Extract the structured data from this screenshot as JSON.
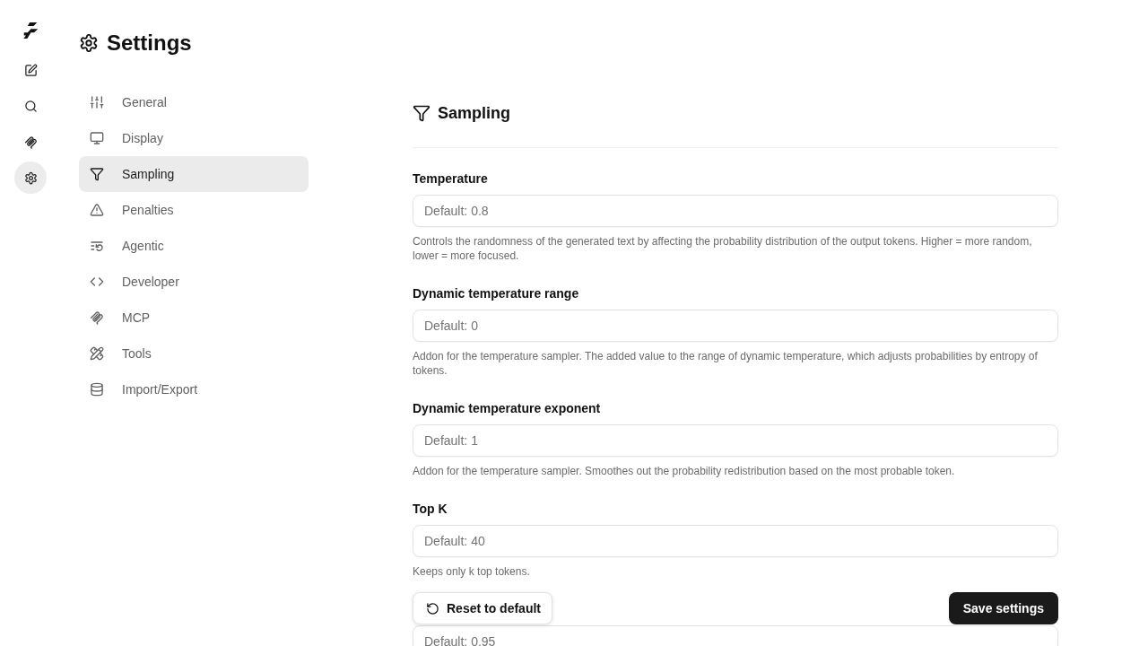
{
  "rail": {
    "items": [
      {
        "selected": false
      },
      {
        "selected": false
      },
      {
        "selected": false
      },
      {
        "selected": true
      }
    ]
  },
  "page_title": "Settings",
  "nav": {
    "items": [
      {
        "label": "General",
        "selected": false
      },
      {
        "label": "Display",
        "selected": false
      },
      {
        "label": "Sampling",
        "selected": true
      },
      {
        "label": "Penalties",
        "selected": false
      },
      {
        "label": "Agentic",
        "selected": false
      },
      {
        "label": "Developer",
        "selected": false
      },
      {
        "label": "MCP",
        "selected": false
      },
      {
        "label": "Tools",
        "selected": false
      },
      {
        "label": "Import/Export",
        "selected": false
      }
    ]
  },
  "section": {
    "title": "Sampling",
    "fields": [
      {
        "label": "Temperature",
        "placeholder": "Default: 0.8",
        "help": "Controls the randomness of the generated text by affecting the probability distribution of the output tokens. Higher = more random, lower = more focused."
      },
      {
        "label": "Dynamic temperature range",
        "placeholder": "Default: 0",
        "help": "Addon for the temperature sampler. The added value to the range of dynamic temperature, which adjusts probabilities by entropy of tokens."
      },
      {
        "label": "Dynamic temperature exponent",
        "placeholder": "Default: 1",
        "help": "Addon for the temperature sampler. Smoothes out the probability redistribution based on the most probable token."
      },
      {
        "label": "Top K",
        "placeholder": "Default: 40",
        "help": "Keeps only k top tokens."
      }
    ]
  },
  "actions": {
    "reset": "Reset to default",
    "save": "Save settings"
  },
  "next_field": {
    "placeholder": "Default: 0.95"
  }
}
